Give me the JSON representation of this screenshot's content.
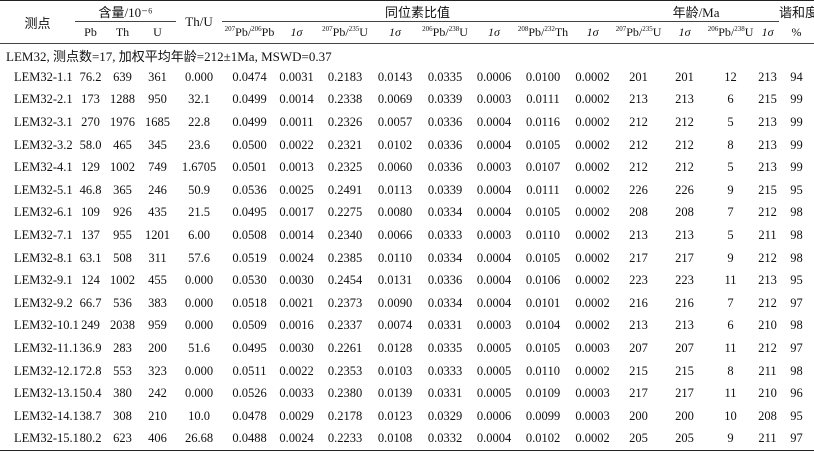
{
  "header": {
    "point_label": "测点",
    "content_group": "含量/10⁻⁶",
    "pb": "Pb",
    "th": "Th",
    "u": "U",
    "thu": "Th/U",
    "ratio_group": "同位素比值",
    "age_group": "年龄/Ma",
    "concordance": "谐和度",
    "iso_76": "207Pb/206Pb",
    "iso_75": "207Pb/235U",
    "iso_68": "206Pb/238U",
    "iso_82": "208Pb/232Th",
    "age_75": "207Pb/235U",
    "age_68": "206Pb/238U",
    "sigma": "1σ",
    "pct": "%"
  },
  "note": "LEM32, 测点数=17, 加权平均年龄=212±1Ma, MSWD=0.37",
  "rows": [
    [
      "LEM32-1.1",
      "76.2",
      "639",
      "361",
      "0.000",
      "0.0474",
      "0.0031",
      "0.2183",
      "0.0143",
      "0.0335",
      "0.0006",
      "0.0100",
      "0.0002",
      "201",
      "201",
      "12",
      "213",
      "94"
    ],
    [
      "LEM32-2.1",
      "173",
      "1288",
      "950",
      "32.1",
      "0.0499",
      "0.0014",
      "0.2338",
      "0.0069",
      "0.0339",
      "0.0003",
      "0.0111",
      "0.0002",
      "213",
      "213",
      "6",
      "215",
      "99"
    ],
    [
      "LEM32-3.1",
      "270",
      "1976",
      "1685",
      "22.8",
      "0.0499",
      "0.0011",
      "0.2326",
      "0.0057",
      "0.0336",
      "0.0004",
      "0.0116",
      "0.0002",
      "212",
      "212",
      "5",
      "213",
      "99"
    ],
    [
      "LEM32-3.2",
      "58.0",
      "465",
      "345",
      "23.6",
      "0.0500",
      "0.0022",
      "0.2321",
      "0.0102",
      "0.0336",
      "0.0004",
      "0.0105",
      "0.0002",
      "212",
      "212",
      "8",
      "213",
      "99"
    ],
    [
      "LEM32-4.1",
      "129",
      "1002",
      "749",
      "1.6705",
      "0.0501",
      "0.0013",
      "0.2325",
      "0.0060",
      "0.0336",
      "0.0003",
      "0.0107",
      "0.0002",
      "212",
      "212",
      "5",
      "213",
      "99"
    ],
    [
      "LEM32-5.1",
      "46.8",
      "365",
      "246",
      "50.9",
      "0.0536",
      "0.0025",
      "0.2491",
      "0.0113",
      "0.0339",
      "0.0004",
      "0.0111",
      "0.0002",
      "226",
      "226",
      "9",
      "215",
      "95"
    ],
    [
      "LEM32-6.1",
      "109",
      "926",
      "435",
      "21.5",
      "0.0495",
      "0.0017",
      "0.2275",
      "0.0080",
      "0.0334",
      "0.0004",
      "0.0105",
      "0.0002",
      "208",
      "208",
      "7",
      "212",
      "98"
    ],
    [
      "LEM32-7.1",
      "137",
      "955",
      "1201",
      "6.00",
      "0.0508",
      "0.0014",
      "0.2340",
      "0.0066",
      "0.0333",
      "0.0003",
      "0.0110",
      "0.0002",
      "213",
      "213",
      "5",
      "211",
      "98"
    ],
    [
      "LEM32-8.1",
      "63.1",
      "508",
      "311",
      "57.6",
      "0.0519",
      "0.0024",
      "0.2385",
      "0.0110",
      "0.0334",
      "0.0004",
      "0.0105",
      "0.0002",
      "217",
      "217",
      "9",
      "212",
      "98"
    ],
    [
      "LEM32-9.1",
      "124",
      "1002",
      "455",
      "0.000",
      "0.0530",
      "0.0030",
      "0.2454",
      "0.0131",
      "0.0336",
      "0.0004",
      "0.0106",
      "0.0002",
      "223",
      "223",
      "11",
      "213",
      "95"
    ],
    [
      "LEM32-9.2",
      "66.7",
      "536",
      "383",
      "0.000",
      "0.0518",
      "0.0021",
      "0.2373",
      "0.0090",
      "0.0334",
      "0.0004",
      "0.0101",
      "0.0002",
      "216",
      "216",
      "7",
      "212",
      "97"
    ],
    [
      "LEM32-10.1",
      "249",
      "2038",
      "959",
      "0.000",
      "0.0509",
      "0.0016",
      "0.2337",
      "0.0074",
      "0.0331",
      "0.0003",
      "0.0104",
      "0.0002",
      "213",
      "213",
      "6",
      "210",
      "98"
    ],
    [
      "LEM32-11.1",
      "36.9",
      "283",
      "200",
      "51.6",
      "0.0495",
      "0.0030",
      "0.2261",
      "0.0128",
      "0.0335",
      "0.0005",
      "0.0105",
      "0.0003",
      "207",
      "207",
      "11",
      "212",
      "97"
    ],
    [
      "LEM32-12.1",
      "72.8",
      "553",
      "323",
      "0.000",
      "0.0511",
      "0.0022",
      "0.2353",
      "0.0103",
      "0.0333",
      "0.0005",
      "0.0110",
      "0.0002",
      "215",
      "215",
      "8",
      "211",
      "98"
    ],
    [
      "LEM32-13.1",
      "50.4",
      "380",
      "242",
      "0.000",
      "0.0526",
      "0.0033",
      "0.2380",
      "0.0139",
      "0.0331",
      "0.0005",
      "0.0109",
      "0.0003",
      "217",
      "217",
      "11",
      "210",
      "96"
    ],
    [
      "LEM32-14.1",
      "38.7",
      "308",
      "210",
      "10.0",
      "0.0478",
      "0.0029",
      "0.2178",
      "0.0123",
      "0.0329",
      "0.0006",
      "0.0099",
      "0.0003",
      "200",
      "200",
      "10",
      "208",
      "95"
    ],
    [
      "LEM32-15.1",
      "80.2",
      "623",
      "406",
      "26.68",
      "0.0488",
      "0.0024",
      "0.2233",
      "0.0108",
      "0.0332",
      "0.0004",
      "0.0102",
      "0.0002",
      "205",
      "205",
      "9",
      "211",
      "97"
    ]
  ]
}
